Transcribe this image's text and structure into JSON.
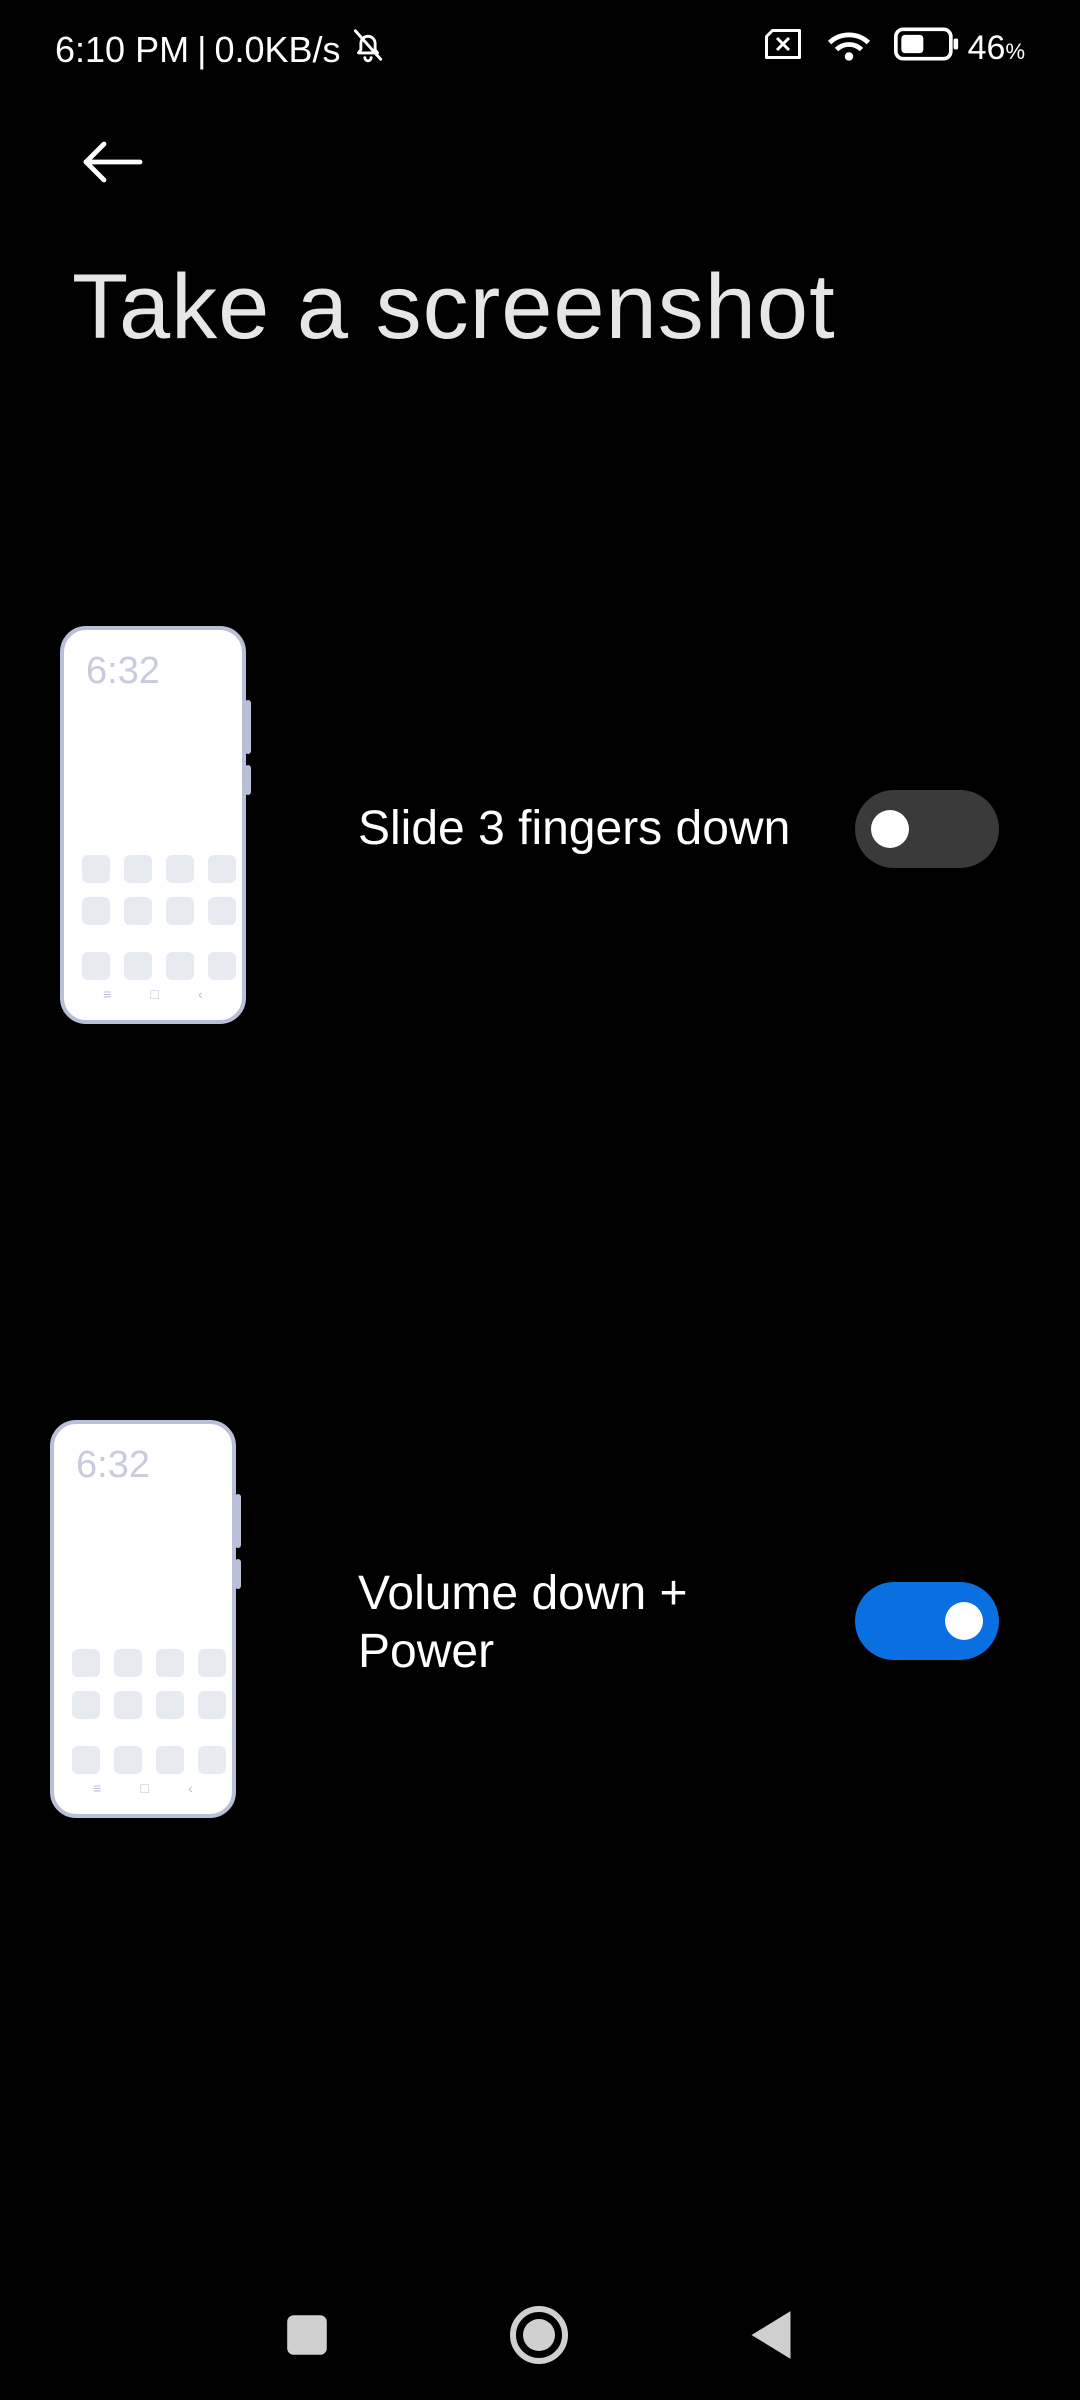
{
  "status_bar": {
    "time": "6:10 PM",
    "separator": "|",
    "network_speed": "0.0KB/s",
    "battery_percent": "46",
    "percent_sign": "%",
    "icons": [
      "bell-muted-icon",
      "sim-no-signal-icon",
      "wifi-icon",
      "battery-icon"
    ]
  },
  "header": {
    "back_icon": "arrow-left-icon",
    "title": "Take a screenshot"
  },
  "options": [
    {
      "label": "Slide 3 fingers down",
      "enabled": false,
      "illustration_time": "6:32"
    },
    {
      "label": "Volume down + Power",
      "enabled": true,
      "illustration_time": "6:32"
    }
  ],
  "colors": {
    "background": "#000000",
    "toggle_on": "#0a6fe0",
    "toggle_off": "#3a3a3a",
    "illustration_outline": "#b9bfd8"
  },
  "nav_bar": {
    "icons": [
      "recents-square-icon",
      "home-circle-icon",
      "back-triangle-icon"
    ]
  }
}
